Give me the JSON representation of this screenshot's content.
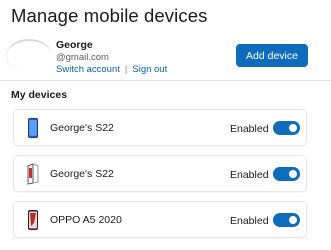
{
  "header": {
    "title": "Manage mobile devices"
  },
  "account": {
    "name": "George",
    "email": "@gmail.com",
    "switch_account_label": "Switch account",
    "separator": "|",
    "sign_out_label": "Sign out",
    "add_device_label": "Add device"
  },
  "devices_section": {
    "title": "My devices",
    "devices": [
      {
        "name": "George's S22",
        "status": "Enabled",
        "enabled": true,
        "icon": "phone-blue-icon"
      },
      {
        "name": "George's S22",
        "status": "Enabled",
        "enabled": true,
        "icon": "phone-folded-icon"
      },
      {
        "name": "OPPO A5 2020",
        "status": "Enabled",
        "enabled": true,
        "icon": "phone-red-icon"
      }
    ]
  },
  "colors": {
    "accent": "#0f6cbd",
    "link": "#0b5fb0"
  }
}
